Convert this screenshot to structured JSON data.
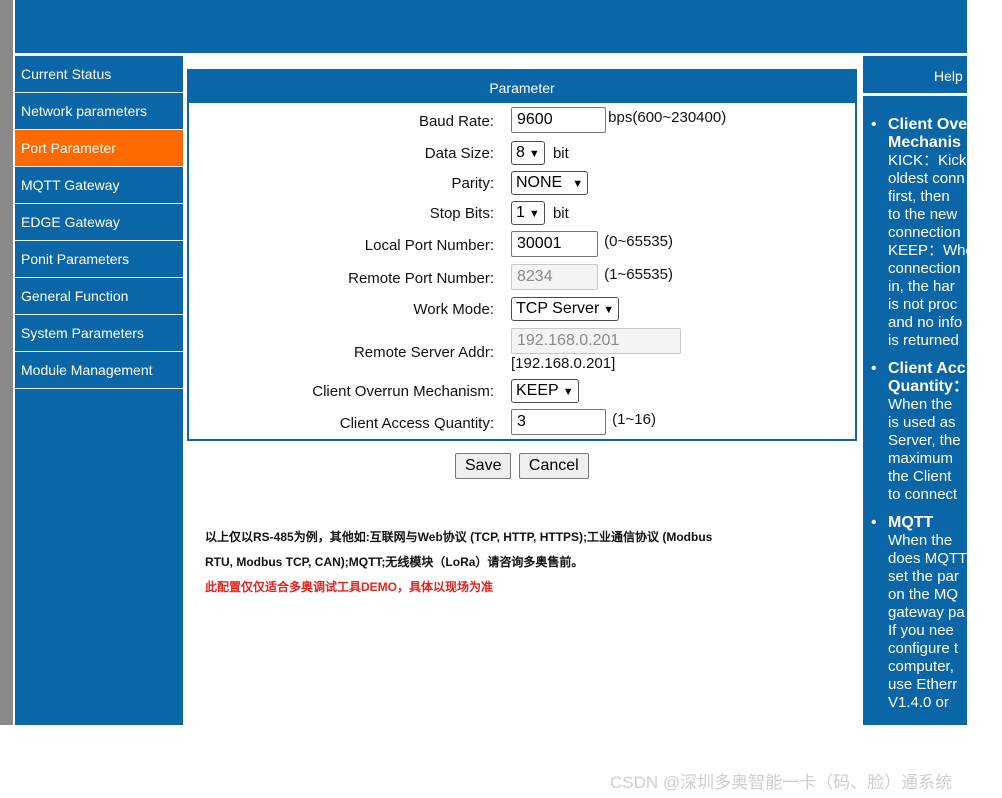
{
  "sidebar": {
    "items": [
      {
        "label": "Current Status"
      },
      {
        "label": "Network parameters"
      },
      {
        "label": "Port Parameter"
      },
      {
        "label": "MQTT Gateway"
      },
      {
        "label": "EDGE Gateway"
      },
      {
        "label": "Ponit Parameters"
      },
      {
        "label": "General Function"
      },
      {
        "label": "System Parameters"
      },
      {
        "label": "Module Management"
      }
    ],
    "active": "Port Parameter"
  },
  "panel": {
    "title": "Parameter",
    "fields": {
      "baud_rate": {
        "label": "Baud Rate:",
        "value": "9600",
        "unit": "bps(600~230400)"
      },
      "data_size": {
        "label": "Data Size:",
        "value": "8",
        "unit": "bit"
      },
      "parity": {
        "label": "Parity:",
        "value": "NONE"
      },
      "stop_bits": {
        "label": "Stop Bits:",
        "value": "1",
        "unit": "bit"
      },
      "local_port": {
        "label": "Local Port Number:",
        "value": "30001",
        "range": "(0~65535)"
      },
      "remote_port": {
        "label": "Remote Port Number:",
        "value": "8234",
        "range": "(1~65535)"
      },
      "work_mode": {
        "label": "Work Mode:",
        "value": "TCP Server"
      },
      "remote_addr": {
        "label": "Remote Server Addr:",
        "value": "192.168.0.201",
        "current": "[192.168.0.201]"
      },
      "overrun": {
        "label": "Client Overrun Mechanism:",
        "value": "KEEP"
      },
      "access_qty": {
        "label": "Client Access Quantity:",
        "value": "3",
        "range": "(1~16)"
      }
    }
  },
  "buttons": {
    "save": "Save",
    "cancel": "Cancel"
  },
  "notes": {
    "line1": "以上仅以RS-485为例，其他如:互联网与Web协议 (TCP, HTTP, HTTPS);工业通信协议 (Modbus",
    "line2": "RTU, Modbus TCP, CAN);MQTT;无线模块（LoRa）请咨询多奥售前。",
    "line3": "此配置仅仅适合多奥调试工具DEMO，具体以现场为准"
  },
  "help": {
    "title": "Help",
    "items": [
      {
        "head": [
          "Client Ove",
          "Mechanis"
        ],
        "lines": [
          "KICK：Kick",
          "oldest conn",
          "first, then",
          "to the new",
          "connection",
          "KEEP：Whe",
          "connection",
          "in, the har",
          "is not proc",
          "and no info",
          "is returned"
        ]
      },
      {
        "head": [
          "Client Acc",
          "Quantity："
        ],
        "lines": [
          "When the",
          "is used as",
          "Server, the",
          "maximum",
          "the Client",
          "to connect"
        ]
      },
      {
        "head": [
          "MQTT"
        ],
        "lines": [
          "When the",
          "does MQTT",
          "set the par",
          "on the MQ",
          "gateway pa",
          "If you nee",
          "configure t",
          "computer,",
          "use Etherr",
          "V1.4.0 or"
        ]
      }
    ]
  },
  "credit": "CSDN @深圳多奥智能一卡（码、脸）通系统"
}
